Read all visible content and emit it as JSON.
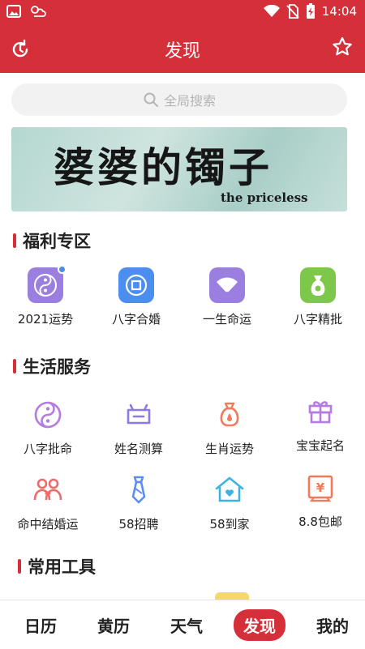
{
  "status_bar": {
    "time": "14:04"
  },
  "header": {
    "title": "发现"
  },
  "search": {
    "placeholder": "全局搜索"
  },
  "banner": {
    "title": "婆婆的镯子",
    "subtitle": "the priceless"
  },
  "sections": {
    "welfare": {
      "title": "福利专区",
      "items": [
        {
          "label": "2021运势",
          "icon": "bagua-icon",
          "color": "#9b7fe0",
          "badge": true
        },
        {
          "label": "八字合婚",
          "icon": "coin-icon",
          "color": "#4b8ef0"
        },
        {
          "label": "一生命运",
          "icon": "fan-icon",
          "color": "#9b7fe0"
        },
        {
          "label": "八字精批",
          "icon": "money-bag-icon",
          "color": "#7dc84a"
        }
      ]
    },
    "life": {
      "title": "生活服务",
      "items": [
        {
          "label": "八字批命",
          "icon": "yin-yang-icon",
          "color": "#b57be0"
        },
        {
          "label": "姓名测算",
          "icon": "name-tag-icon",
          "color": "#8a7be8"
        },
        {
          "label": "生肖运势",
          "icon": "lucky-bag-icon",
          "color": "#f07a5a"
        },
        {
          "label": "宝宝起名",
          "icon": "gift-icon",
          "color": "#b57be0"
        },
        {
          "label": "命中结婚运",
          "icon": "couple-icon",
          "color": "#ef6b6b"
        },
        {
          "label": "58招聘",
          "icon": "tie-icon",
          "color": "#5b8ef0"
        },
        {
          "label": "58到家",
          "icon": "house-icon",
          "color": "#3fb3e0"
        },
        {
          "label": "8.8包邮",
          "icon": "yuan-tag-icon",
          "color": "#f07a5a"
        }
      ]
    },
    "tools": {
      "title": "常用工具"
    }
  },
  "tabs": [
    {
      "label": "日历"
    },
    {
      "label": "黄历"
    },
    {
      "label": "天气"
    },
    {
      "label": "发现",
      "active": true
    },
    {
      "label": "我的"
    }
  ],
  "colors": {
    "primary": "#d5303a"
  }
}
